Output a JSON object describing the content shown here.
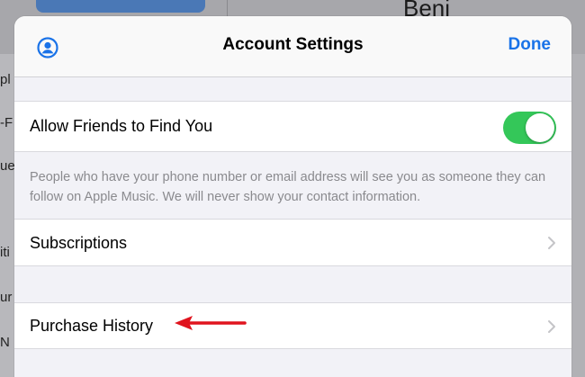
{
  "background": {
    "title_fragment": "Beni",
    "row_fragments": [
      "pl",
      "-F",
      "ue",
      "iti",
      "ur",
      "N"
    ]
  },
  "navbar": {
    "title": "Account Settings",
    "done_label": "Done",
    "profile_icon": "person-circle-icon"
  },
  "friends_section": {
    "toggle_label": "Allow Friends to Find You",
    "toggle_on": true,
    "footer": "People who have your phone number or email address will see you as someone they can follow on Apple Music. We will never show your contact information."
  },
  "rows": [
    {
      "label": "Subscriptions",
      "icon": "chevron-right-icon"
    },
    {
      "label": "Purchase History",
      "icon": "chevron-right-icon"
    }
  ],
  "annotation": {
    "icon": "red-arrow-icon"
  },
  "colors": {
    "accent": "#1a73e8",
    "toggle_on": "#34c759",
    "annotation": "#e0141e",
    "group_background": "#f2f2f7"
  }
}
